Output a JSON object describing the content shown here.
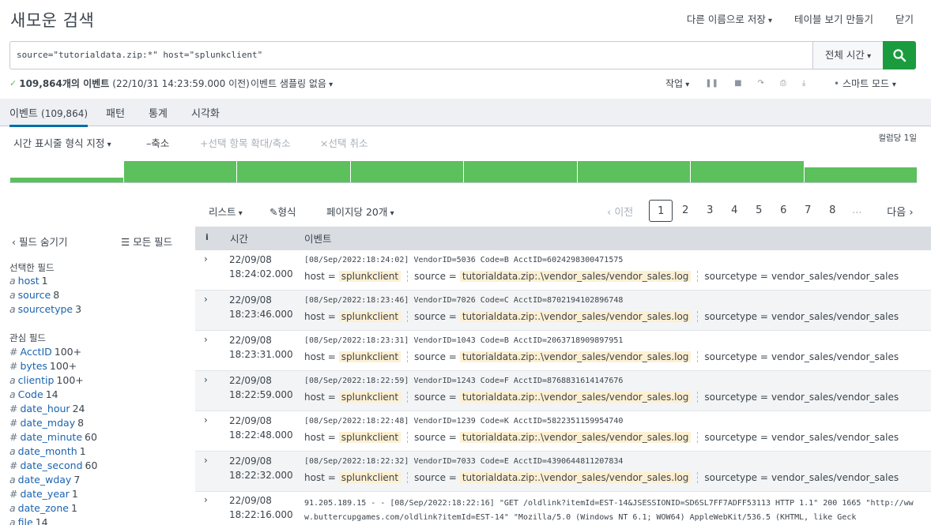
{
  "header": {
    "title": "새모운 검색",
    "save_as": "다른 이름으로 저장",
    "create_table": "테이블 보기 만들기",
    "close": "닫기"
  },
  "search": {
    "query": "source=\"tutorialdata.zip:*\" host=\"splunkclient\"",
    "time_range": "전체 시간",
    "search_icon": "search-icon"
  },
  "status": {
    "check": "✓",
    "count_text": "109,864개의 이벤트",
    "timestamp": "(22/10/31 14:23:59.000 이전)",
    "sampling": "이벤트 샘플링 없음",
    "job": "작업",
    "smart_mode": "스마트 모드"
  },
  "tabs": {
    "events_label": "이벤트",
    "events_count": "(109,864)",
    "patterns": "패턴",
    "stats": "통계",
    "visualization": "시각화"
  },
  "timeline": {
    "format": "시간 표시줄 형식 지정",
    "zoom_out": "축소",
    "zoom_selection": "선택 항목 확대/축소",
    "deselect": "선택 취소",
    "scale": "컬럼당 1일",
    "bars": [
      0.2,
      0.85,
      0.85,
      0.85,
      0.85,
      0.85,
      0.85,
      0.6
    ]
  },
  "results_toolbar": {
    "list": "리스트",
    "format": "형식",
    "per_page": "페이지당 20개",
    "prev": "이전",
    "pages": [
      "1",
      "2",
      "3",
      "4",
      "5",
      "6",
      "7",
      "8"
    ],
    "ellipsis": "...",
    "next": "다음"
  },
  "sidebar": {
    "hide_fields": "필드 숨기기",
    "all_fields": "모든 필드",
    "selected_heading": "선택한 필드",
    "selected": [
      {
        "type": "a",
        "name": "host",
        "count": "1"
      },
      {
        "type": "a",
        "name": "source",
        "count": "8"
      },
      {
        "type": "a",
        "name": "sourcetype",
        "count": "3"
      }
    ],
    "interesting_heading": "관심 필드",
    "interesting": [
      {
        "type": "#",
        "name": "AcctID",
        "count": "100+"
      },
      {
        "type": "#",
        "name": "bytes",
        "count": "100+"
      },
      {
        "type": "a",
        "name": "clientip",
        "count": "100+"
      },
      {
        "type": "a",
        "name": "Code",
        "count": "14"
      },
      {
        "type": "#",
        "name": "date_hour",
        "count": "24"
      },
      {
        "type": "#",
        "name": "date_mday",
        "count": "8"
      },
      {
        "type": "#",
        "name": "date_minute",
        "count": "60"
      },
      {
        "type": "a",
        "name": "date_month",
        "count": "1"
      },
      {
        "type": "#",
        "name": "date_second",
        "count": "60"
      },
      {
        "type": "a",
        "name": "date_wday",
        "count": "7"
      },
      {
        "type": "#",
        "name": "date_year",
        "count": "1"
      },
      {
        "type": "a",
        "name": "date_zone",
        "count": "1"
      },
      {
        "type": "a",
        "name": "file",
        "count": "14"
      }
    ]
  },
  "table": {
    "col_info": "i",
    "col_time": "시간",
    "col_event": "이벤트",
    "meta_host_key": "host =",
    "meta_source_key": "source =",
    "meta_sourcetype_key": "sourcetype =",
    "rows": [
      {
        "date": "22/09/08",
        "time": "18:24:02.000",
        "raw": "[08/Sep/2022:18:24:02] VendorID=5036 Code=B AcctID=6024298300471575",
        "host": "splunkclient",
        "source": "tutorialdata.zip:.\\vendor_sales/vendor_sales.log",
        "sourcetype": "vendor_sales/vendor_sales"
      },
      {
        "date": "22/09/08",
        "time": "18:23:46.000",
        "raw": "[08/Sep/2022:18:23:46] VendorID=7026 Code=C AcctID=8702194102896748",
        "host": "splunkclient",
        "source": "tutorialdata.zip:.\\vendor_sales/vendor_sales.log",
        "sourcetype": "vendor_sales/vendor_sales"
      },
      {
        "date": "22/09/08",
        "time": "18:23:31.000",
        "raw": "[08/Sep/2022:18:23:31] VendorID=1043 Code=B AcctID=2063718909897951",
        "host": "splunkclient",
        "source": "tutorialdata.zip:.\\vendor_sales/vendor_sales.log",
        "sourcetype": "vendor_sales/vendor_sales"
      },
      {
        "date": "22/09/08",
        "time": "18:22:59.000",
        "raw": "[08/Sep/2022:18:22:59] VendorID=1243 Code=F AcctID=8768831614147676",
        "host": "splunkclient",
        "source": "tutorialdata.zip:.\\vendor_sales/vendor_sales.log",
        "sourcetype": "vendor_sales/vendor_sales"
      },
      {
        "date": "22/09/08",
        "time": "18:22:48.000",
        "raw": "[08/Sep/2022:18:22:48] VendorID=1239 Code=K AcctID=5822351159954740",
        "host": "splunkclient",
        "source": "tutorialdata.zip:.\\vendor_sales/vendor_sales.log",
        "sourcetype": "vendor_sales/vendor_sales"
      },
      {
        "date": "22/09/08",
        "time": "18:22:32.000",
        "raw": "[08/Sep/2022:18:22:32] VendorID=7033 Code=E AcctID=4390644811207834",
        "host": "splunkclient",
        "source": "tutorialdata.zip:.\\vendor_sales/vendor_sales.log",
        "sourcetype": "vendor_sales/vendor_sales"
      }
    ],
    "last_row": {
      "date": "22/09/08",
      "time": "18:22:16.000",
      "raw": "91.205.189.15 - - [08/Sep/2022:18:22:16] \"GET /oldlink?itemId=EST-14&JSESSIONID=SD6SL7FF7ADFF53113 HTTP 1.1\" 200 1665 \"http://www.buttercupgames.com/oldlink?itemId=EST-14\" \"Mozilla/5.0 (Windows NT 6.1; WOW64) AppleWebKit/536.5 (KHTML, like Geck"
    }
  },
  "colors": {
    "accent_green": "#1a9c3e",
    "bar_green": "#5cc05c",
    "link_blue": "#1a63b0",
    "highlight": "#fdf0d2"
  }
}
